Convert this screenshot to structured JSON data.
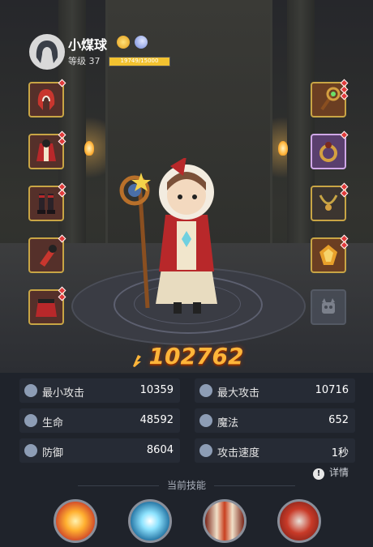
{
  "player": {
    "name": "小煤球",
    "level_label": "等级 37",
    "xp_text": "19749/15000",
    "xp_fraction": 1.0,
    "badges": [
      "sun-badge-icon",
      "moon-badge-icon"
    ]
  },
  "equipment": {
    "left": [
      {
        "name": "hood-icon",
        "upgrades": 1
      },
      {
        "name": "robe-icon",
        "upgrades": 2
      },
      {
        "name": "boots-icon",
        "upgrades": 2
      },
      {
        "name": "bracer-icon",
        "upgrades": 1
      },
      {
        "name": "cloak-icon",
        "upgrades": 2
      }
    ],
    "right": [
      {
        "name": "staff-icon",
        "upgrades": 3
      },
      {
        "name": "ring-icon",
        "upgrades": 1
      },
      {
        "name": "necklace-icon",
        "upgrades": 2
      },
      {
        "name": "gem-icon",
        "upgrades": 2
      },
      {
        "name": "pet-slot-icon",
        "upgrades": 0
      }
    ]
  },
  "power": {
    "value": "102762"
  },
  "stats": [
    {
      "label": "最小攻击",
      "value": "10359",
      "icon": "min-attack-icon"
    },
    {
      "label": "最大攻击",
      "value": "10716",
      "icon": "max-attack-icon"
    },
    {
      "label": "生命",
      "value": "48592",
      "icon": "health-icon"
    },
    {
      "label": "魔法",
      "value": "652",
      "icon": "magic-icon"
    },
    {
      "label": "防御",
      "value": "8604",
      "icon": "defense-icon"
    },
    {
      "label": "攻击速度",
      "value": "1秒",
      "icon": "attack-speed-icon"
    }
  ],
  "detail_label": "详情",
  "skills": {
    "title": "当前技能",
    "items": [
      "explosion-skill-icon",
      "frost-orb-skill-icon",
      "fire-pillar-skill-icon",
      "crossed-axes-skill-icon"
    ]
  },
  "colors": {
    "accent": "#ffb53a",
    "panel": "#1f232b",
    "row": "#262b35",
    "slot_border": "#c8a545"
  }
}
